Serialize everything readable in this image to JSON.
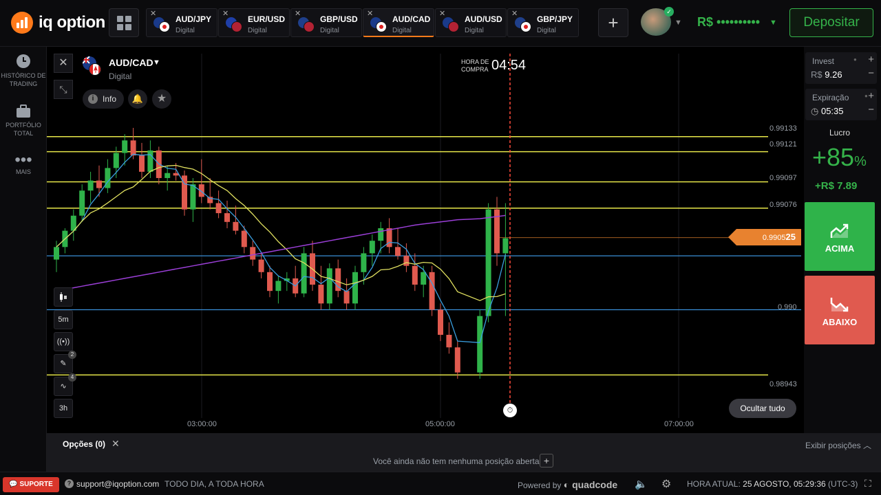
{
  "brand": {
    "name": "iq option"
  },
  "header": {
    "tabs": [
      {
        "name": "AUD/JPY",
        "sub": "Digital",
        "f1": "aus",
        "f2": "jpn"
      },
      {
        "name": "EUR/USD",
        "sub": "Digital",
        "f1": "eur",
        "f2": "usa"
      },
      {
        "name": "GBP/USD",
        "sub": "Digital",
        "f1": "gbr",
        "f2": "usa"
      },
      {
        "name": "AUD/CAD",
        "sub": "Digital",
        "f1": "aus",
        "f2": "can",
        "active": true
      },
      {
        "name": "AUD/USD",
        "sub": "Digital",
        "f1": "aus",
        "f2": "usa"
      },
      {
        "name": "GBP/JPY",
        "sub": "Digital",
        "f1": "gbr",
        "f2": "jpn"
      }
    ],
    "add_tab": "+",
    "balance": "R$ ••••••••••",
    "deposit_label": "Depositar"
  },
  "sidebar": {
    "items": [
      {
        "label": "HISTÓRICO DE TRADING",
        "icon": "clock-icon"
      },
      {
        "label": "PORTFÓLIO TOTAL",
        "icon": "briefcase-icon"
      },
      {
        "label": "MAIS",
        "icon": "more-dots-icon"
      }
    ]
  },
  "chart": {
    "asset": "AUD/CAD",
    "asset_type": "Digital",
    "info_label": "Info",
    "buy_time_label": "HORA DE COMPRA",
    "buy_time": "04:54",
    "timeframe": "5m",
    "period": "3h",
    "drawing_badge": "2",
    "indicator_badge": "4",
    "hide_all": "Ocultar tudo",
    "current_price_prefix": "0.9905",
    "current_price_suffix": "25",
    "price_levels": [
      "0.99133",
      "0.99121",
      "0.99097",
      "0.99076",
      "0.990",
      "0.98943"
    ],
    "time_labels": [
      "03:00:00",
      "05:00:00",
      "07:00:00"
    ],
    "colors": {
      "up": "#2fb34a",
      "down": "#e05a4f",
      "level": "#e8e84a",
      "accent": "#ff7a1a"
    }
  },
  "chart_data": {
    "type": "candlestick",
    "series_ohlc": [
      [
        0.99035,
        0.9905,
        0.99025,
        0.99045
      ],
      [
        0.99045,
        0.9906,
        0.9904,
        0.99058
      ],
      [
        0.99058,
        0.99075,
        0.9905,
        0.9907
      ],
      [
        0.9907,
        0.99095,
        0.99065,
        0.9909
      ],
      [
        0.9909,
        0.99105,
        0.9908,
        0.99098
      ],
      [
        0.99098,
        0.9911,
        0.99085,
        0.99092
      ],
      [
        0.99092,
        0.99115,
        0.99088,
        0.99108
      ],
      [
        0.99108,
        0.99125,
        0.991,
        0.9912
      ],
      [
        0.9912,
        0.99135,
        0.9911,
        0.9913
      ],
      [
        0.9913,
        0.9914,
        0.99115,
        0.99118
      ],
      [
        0.99118,
        0.99128,
        0.991,
        0.99105
      ],
      [
        0.99105,
        0.9913,
        0.991,
        0.99122
      ],
      [
        0.99122,
        0.99125,
        0.99095,
        0.991
      ],
      [
        0.991,
        0.9911,
        0.9909,
        0.99104
      ],
      [
        0.99104,
        0.99112,
        0.99098,
        0.99102
      ],
      [
        0.99102,
        0.99106,
        0.9907,
        0.99075
      ],
      [
        0.99075,
        0.991,
        0.99065,
        0.99095
      ],
      [
        0.99095,
        0.99115,
        0.9908,
        0.99085
      ],
      [
        0.99085,
        0.991,
        0.99075,
        0.9908
      ],
      [
        0.9908,
        0.9909,
        0.99068,
        0.99072
      ],
      [
        0.99072,
        0.99082,
        0.9906,
        0.99065
      ],
      [
        0.99065,
        0.99078,
        0.99055,
        0.99058
      ],
      [
        0.99058,
        0.99062,
        0.9904,
        0.99045
      ],
      [
        0.99045,
        0.9905,
        0.9903,
        0.99035
      ],
      [
        0.99035,
        0.9904,
        0.9902,
        0.99025
      ],
      [
        0.99025,
        0.9903,
        0.99005,
        0.9901
      ],
      [
        0.9901,
        0.99022,
        0.99,
        0.99018
      ],
      [
        0.99018,
        0.99025,
        0.9901,
        0.9902
      ],
      [
        0.9902,
        0.9903,
        0.99005,
        0.99008
      ],
      [
        0.99008,
        0.99045,
        0.99005,
        0.9904
      ],
      [
        0.9904,
        0.9905,
        0.9901,
        0.99015
      ],
      [
        0.99015,
        0.9903,
        0.98995,
        0.99
      ],
      [
        0.99,
        0.99032,
        0.98995,
        0.99028
      ],
      [
        0.99028,
        0.99035,
        0.99005,
        0.9901
      ],
      [
        0.9901,
        0.9902,
        0.98995,
        0.99
      ],
      [
        0.99,
        0.9903,
        0.98995,
        0.99025
      ],
      [
        0.99025,
        0.99045,
        0.99015,
        0.9904
      ],
      [
        0.9904,
        0.99055,
        0.9903,
        0.9905
      ],
      [
        0.9905,
        0.99065,
        0.9904,
        0.9906
      ],
      [
        0.9906,
        0.99068,
        0.9904,
        0.99045
      ],
      [
        0.99045,
        0.9906,
        0.99035,
        0.99038
      ],
      [
        0.99038,
        0.99048,
        0.99025,
        0.9903
      ],
      [
        0.9903,
        0.9904,
        0.9901,
        0.99015
      ],
      [
        0.99015,
        0.9903,
        0.99005,
        0.99025
      ],
      [
        0.99025,
        0.9903,
        0.9899,
        0.98995
      ],
      [
        0.98995,
        0.99,
        0.9897,
        0.98975
      ],
      [
        0.98975,
        0.98985,
        0.9896,
        0.98965
      ],
      [
        0.98965,
        0.9897,
        0.9894,
        0.98945
      ],
      [
        0.98945,
        0.98995,
        0.9894,
        0.9899
      ],
      [
        0.9899,
        0.9908,
        0.98985,
        0.99075
      ],
      [
        0.99075,
        0.99085,
        0.9903,
        0.9904
      ],
      [
        0.9904,
        0.9908,
        0.9899,
        0.99052
      ]
    ],
    "horizontal_levels": [
      0.99133,
      0.99121,
      0.99097,
      0.99076,
      0.98943
    ],
    "current_price": 0.990525,
    "ylim": [
      0.98935,
      0.9914
    ],
    "x_tick_labels": [
      "03:00:00",
      "05:00:00",
      "07:00:00"
    ]
  },
  "trade": {
    "invest_label": "Invest",
    "invest_currency": "R$",
    "invest_value": "9.26",
    "expiry_label": "Expiração",
    "expiry_value": "05:35",
    "profit_label": "Lucro",
    "profit_pct": "+85",
    "profit_pct_sign": "%",
    "profit_amount": "+R$ 7.89",
    "up_label": "ACIMA",
    "down_label": "ABAIXO"
  },
  "options": {
    "title": "Opções (0)",
    "empty_text": "Você ainda não tem nenhuma posição aberta",
    "show_positions": "Exibir posições"
  },
  "footer": {
    "support": "SUPORTE",
    "email": "support@iqoption.com",
    "hours": "TODO DIA, A TODA HORA",
    "powered_by": "Powered by",
    "powered_brand": "quadcode",
    "time_label": "HORA ATUAL:",
    "time_value": "25 AGOSTO, 05:29:36",
    "timezone": "(UTC-3)"
  }
}
